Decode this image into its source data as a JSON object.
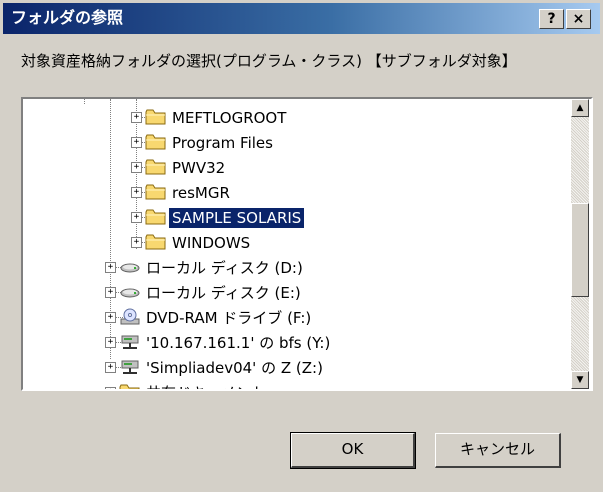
{
  "window": {
    "title": "フォルダの参照"
  },
  "title_buttons": {
    "help": "?",
    "close": "×"
  },
  "caption": "対象資産格納フォルダの選択(プログラム・クラス) 【サブフォルダ対象】",
  "tree": {
    "folders": [
      {
        "label": "MEFTLOGROOT",
        "selected": false
      },
      {
        "label": "Program Files",
        "selected": false
      },
      {
        "label": "PWV32",
        "selected": false
      },
      {
        "label": "resMGR",
        "selected": false
      },
      {
        "label": "SAMPLE SOLARIS",
        "selected": true
      },
      {
        "label": "WINDOWS",
        "selected": false
      }
    ],
    "drives": [
      {
        "label": "ローカル ディスク (D:)",
        "icon": "local-disk-icon"
      },
      {
        "label": "ローカル ディスク (E:)",
        "icon": "local-disk-icon"
      },
      {
        "label": "DVD-RAM ドライブ (F:)",
        "icon": "dvd-drive-icon"
      },
      {
        "label": "'10.167.161.1' の bfs (Y:)",
        "icon": "network-drive-icon"
      },
      {
        "label": "'Simpliadev04' の Z (Z:)",
        "icon": "network-drive-icon"
      },
      {
        "label": "共有ドキュメント",
        "icon": "shared-folder-icon"
      }
    ],
    "expander_symbol": "+"
  },
  "scrollbar": {
    "up": "▲",
    "down": "▼"
  },
  "buttons": {
    "ok": "OK",
    "cancel": "キャンセル"
  },
  "colors": {
    "title_start": "#0a246a",
    "title_end": "#a6caf0",
    "selection": "#0a246a",
    "face": "#d4d0c8"
  }
}
